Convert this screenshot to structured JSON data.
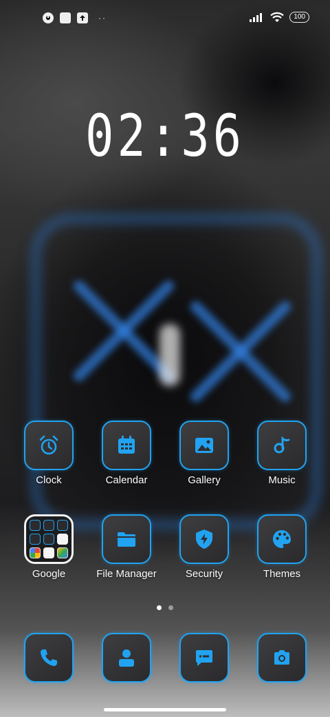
{
  "status_bar": {
    "battery_level": "100",
    "left_icons": [
      "app-notification-icon",
      "square-icon",
      "upload-icon",
      "more-dots-icon"
    ],
    "right_icons": [
      "signal-icon",
      "wifi-icon",
      "battery-icon"
    ],
    "more_indicator": "··"
  },
  "clock": {
    "time": "02:36"
  },
  "apps": {
    "clock": "Clock",
    "calendar": "Calendar",
    "gallery": "Gallery",
    "music": "Music",
    "google": "Google",
    "file_manager": "File Manager",
    "security": "Security",
    "themes": "Themes"
  },
  "page_indicator": {
    "pages": 2,
    "current": 1
  },
  "dock": [
    "phone-icon",
    "contacts-icon",
    "messages-icon",
    "camera-icon"
  ],
  "colors": {
    "accent": "#21a3f1",
    "tile_bg": "#333335",
    "folder_border": "#f2f2f2"
  }
}
